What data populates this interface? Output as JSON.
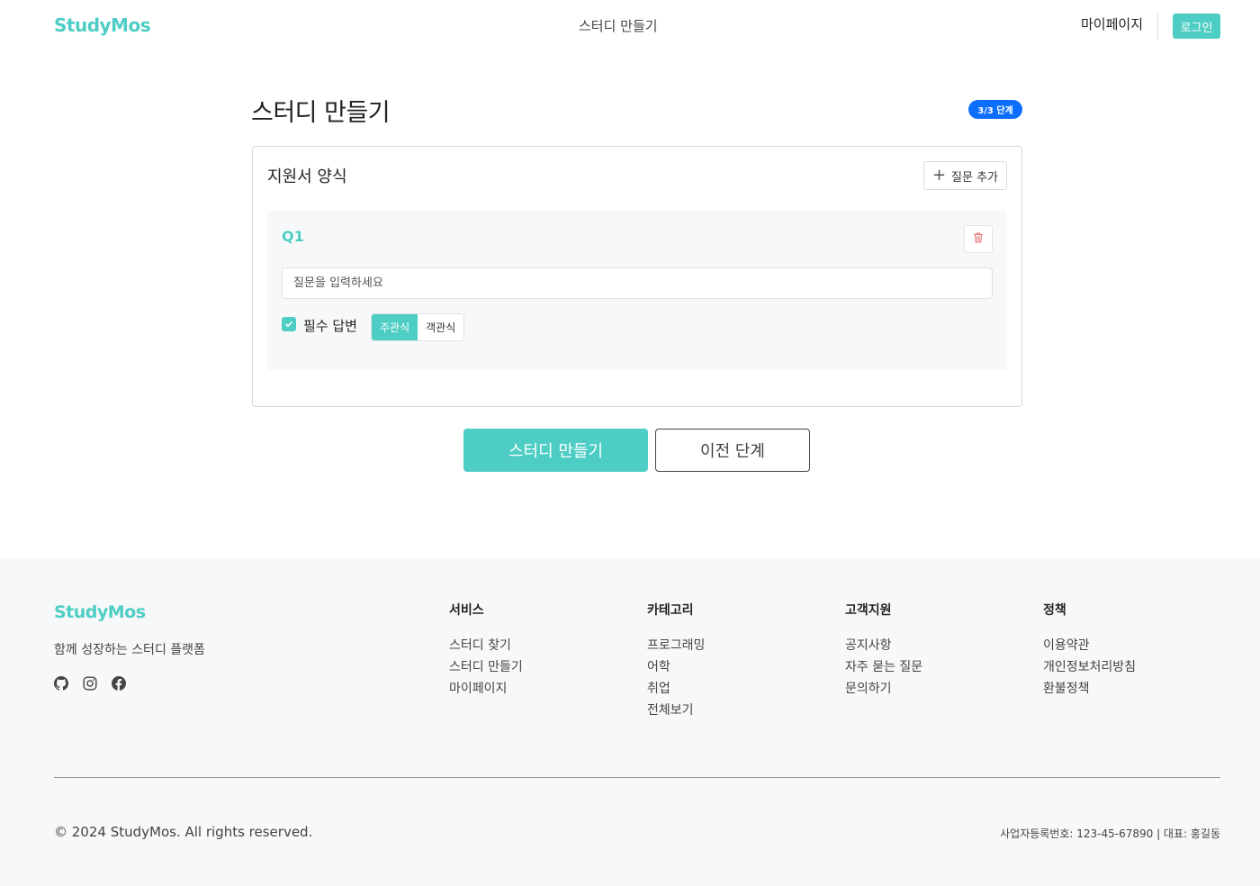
{
  "header": {
    "logo": "StudyMos",
    "nav_create": "스터디 만들기",
    "nav_mypage": "마이페이지",
    "login": "로그인"
  },
  "page": {
    "title": "스터디 만들기",
    "step_badge": "3/3 단계"
  },
  "form": {
    "section_title": "지원서 양식",
    "add_question": "질문 추가",
    "questions": [
      {
        "label": "Q1",
        "placeholder": "질문을 입력하세요",
        "required_label": "필수 답변",
        "required": true,
        "types": [
          "주관식",
          "객관식"
        ],
        "selected_type": "주관식"
      }
    ]
  },
  "actions": {
    "submit": "스터디 만들기",
    "prev": "이전 단계"
  },
  "footer": {
    "logo": "StudyMos",
    "tagline": "함께 성장하는 스터디 플랫폼",
    "social_icons": [
      "github-icon",
      "instagram-icon",
      "facebook-icon"
    ],
    "columns": [
      {
        "title": "서비스",
        "items": [
          "스터디 찾기",
          "스터디 만들기",
          "마이페이지"
        ]
      },
      {
        "title": "카테고리",
        "items": [
          "프로그래밍",
          "어학",
          "취업",
          "전체보기"
        ]
      },
      {
        "title": "고객지원",
        "items": [
          "공지사항",
          "자주 묻는 질문",
          "문의하기"
        ]
      },
      {
        "title": "정책",
        "items": [
          "이용약관",
          "개인정보처리방침",
          "환불정책"
        ]
      }
    ],
    "copyright": "© 2024 StudyMos. All rights reserved.",
    "business_info": "사업자등록번호: 123-45-67890 | 대표: 홍길동"
  },
  "colors": {
    "accent": "#4ecdc4",
    "badge": "#0d6efd",
    "delete_icon": "#e57373"
  }
}
